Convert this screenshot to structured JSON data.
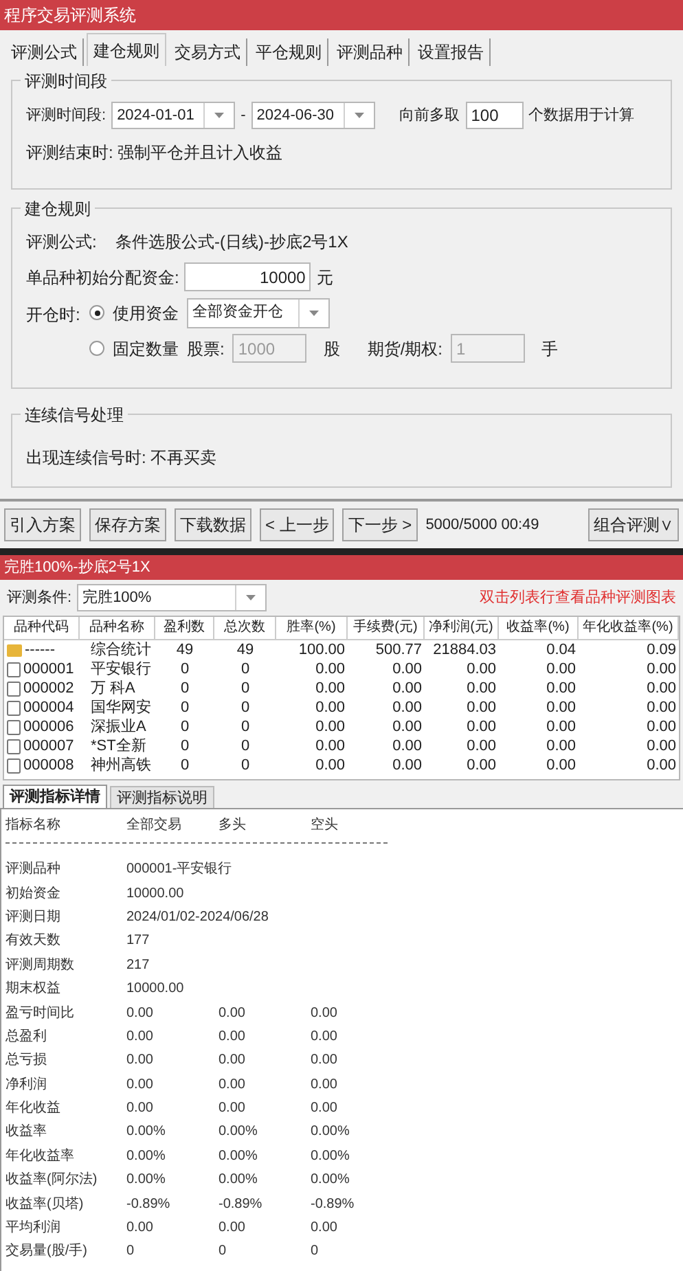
{
  "window": {
    "title": "程序交易评测系统"
  },
  "tabs": [
    {
      "label": "评测公式",
      "selected": false
    },
    {
      "label": "建仓规则",
      "selected": true
    },
    {
      "label": "交易方式",
      "selected": false
    },
    {
      "label": "平仓规则",
      "selected": false
    },
    {
      "label": "评测品种",
      "selected": false
    },
    {
      "label": "设置报告",
      "selected": false
    }
  ],
  "period_group": {
    "title": "评测时间段",
    "label": "评测时间段:",
    "start": "2024-01-01",
    "separator": "-",
    "end": "2024-06-30",
    "lookback_label": "向前多取",
    "lookback_value": "100",
    "lookback_suffix": "个数据用于计算",
    "end_rule": "评测结束时: 强制平仓并且计入收益"
  },
  "open_group": {
    "title": "建仓规则",
    "formula_label": "评测公式:",
    "formula": "条件选股公式-(日线)-抄底2号1X",
    "capital_label": "单品种初始分配资金:",
    "capital": "10000",
    "capital_unit": "元",
    "open_label": "开仓时:",
    "options": [
      {
        "label": "使用资金",
        "selected": true,
        "kind": "select",
        "value": "全部资金开仓"
      },
      {
        "label": "固定数量",
        "selected": false,
        "kind": "quantity",
        "stock_label": "股票:",
        "stock_value": "1000",
        "stock_unit": "股",
        "futures_label": "期货/期权:",
        "futures_value": "1",
        "futures_unit": "手"
      }
    ]
  },
  "signal_group": {
    "title": "连续信号处理",
    "text": "出现连续信号时: 不再买卖"
  },
  "buttons": [
    "引入方案",
    "保存方案",
    "下载数据",
    "< 上一步",
    "下一步 >"
  ],
  "progress": "5000/5000  00:49",
  "combo_button": "组合评测∨",
  "results": {
    "title": "完胜100%-抄底2号1X",
    "condition_label": "评测条件:",
    "condition": "完胜100%",
    "hint": "双击列表行查看品种评测图表",
    "columns": [
      "品种代码",
      "品种名称",
      "盈利数",
      "总次数",
      "胜率(%)",
      "手续费(元)",
      "净利润(元)",
      "收益率(%)",
      "年化收益率(%)"
    ],
    "rows": [
      {
        "kind": "summary",
        "cells": [
          "------",
          "综合统计",
          "49",
          "49",
          "100.00",
          "500.77",
          "21884.03",
          "0.04",
          "0.09"
        ]
      },
      {
        "kind": "stock",
        "cells": [
          "000001",
          "平安银行",
          "0",
          "0",
          "0.00",
          "0.00",
          "0.00",
          "0.00",
          "0.00"
        ]
      },
      {
        "kind": "stock",
        "cells": [
          "000002",
          "万 科A",
          "0",
          "0",
          "0.00",
          "0.00",
          "0.00",
          "0.00",
          "0.00"
        ]
      },
      {
        "kind": "stock",
        "cells": [
          "000004",
          "国华网安",
          "0",
          "0",
          "0.00",
          "0.00",
          "0.00",
          "0.00",
          "0.00"
        ]
      },
      {
        "kind": "stock",
        "cells": [
          "000006",
          "深振业A",
          "0",
          "0",
          "0.00",
          "0.00",
          "0.00",
          "0.00",
          "0.00"
        ]
      },
      {
        "kind": "stock",
        "cells": [
          "000007",
          "*ST全新",
          "0",
          "0",
          "0.00",
          "0.00",
          "0.00",
          "0.00",
          "0.00"
        ]
      },
      {
        "kind": "stock",
        "cells": [
          "000008",
          "神州高铁",
          "0",
          "0",
          "0.00",
          "0.00",
          "0.00",
          "0.00",
          "0.00"
        ]
      }
    ]
  },
  "detail_tabs": [
    {
      "label": "评测指标详情",
      "selected": true
    },
    {
      "label": "评测指标说明",
      "selected": false
    }
  ],
  "detail": {
    "header": [
      "指标名称",
      "全部交易",
      "多头",
      "空头"
    ],
    "rows": [
      {
        "label": "评测品种",
        "values": [
          "000001-平安银行"
        ]
      },
      {
        "label": "初始资金",
        "values": [
          "10000.00"
        ]
      },
      {
        "label": "评测日期",
        "values": [
          "2024/01/02-2024/06/28"
        ]
      },
      {
        "label": "有效天数",
        "values": [
          "177"
        ]
      },
      {
        "label": "评测周期数",
        "values": [
          "217"
        ]
      },
      {
        "label": "期末权益",
        "values": [
          "10000.00"
        ]
      },
      {
        "label": "盈亏时间比",
        "values": [
          "0.00",
          "0.00",
          "0.00"
        ]
      },
      {
        "label": "总盈利",
        "values": [
          "0.00",
          "0.00",
          "0.00"
        ]
      },
      {
        "label": "总亏损",
        "values": [
          "0.00",
          "0.00",
          "0.00"
        ]
      },
      {
        "label": "净利润",
        "values": [
          "0.00",
          "0.00",
          "0.00"
        ]
      },
      {
        "label": "年化收益",
        "values": [
          "0.00",
          "0.00",
          "0.00"
        ]
      },
      {
        "label": "收益率",
        "values": [
          "0.00%",
          "0.00%",
          "0.00%"
        ]
      },
      {
        "label": "年化收益率",
        "values": [
          "0.00%",
          "0.00%",
          "0.00%"
        ]
      },
      {
        "label": "收益率(阿尔法)",
        "values": [
          "0.00%",
          "0.00%",
          "0.00%"
        ]
      },
      {
        "label": "收益率(贝塔)",
        "values": [
          "-0.89%",
          "-0.89%",
          "-0.89%"
        ]
      },
      {
        "label": "平均利润",
        "values": [
          "0.00",
          "0.00",
          "0.00"
        ]
      },
      {
        "label": "交易量(股/手)",
        "values": [
          "0",
          "0",
          "0"
        ]
      }
    ]
  }
}
